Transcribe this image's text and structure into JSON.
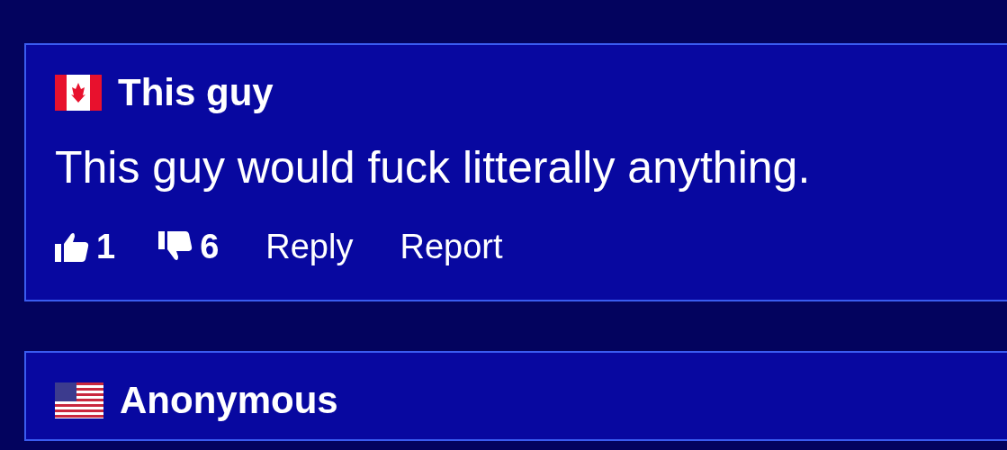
{
  "comments": [
    {
      "kind": "canada",
      "author": "This guy",
      "text": "This guy would fuck litterally anything.",
      "likes": "1",
      "dislikes": "6",
      "actions": [
        "Reply",
        "Report"
      ]
    },
    {
      "kind": "usa",
      "author": "Anonymous"
    }
  ]
}
